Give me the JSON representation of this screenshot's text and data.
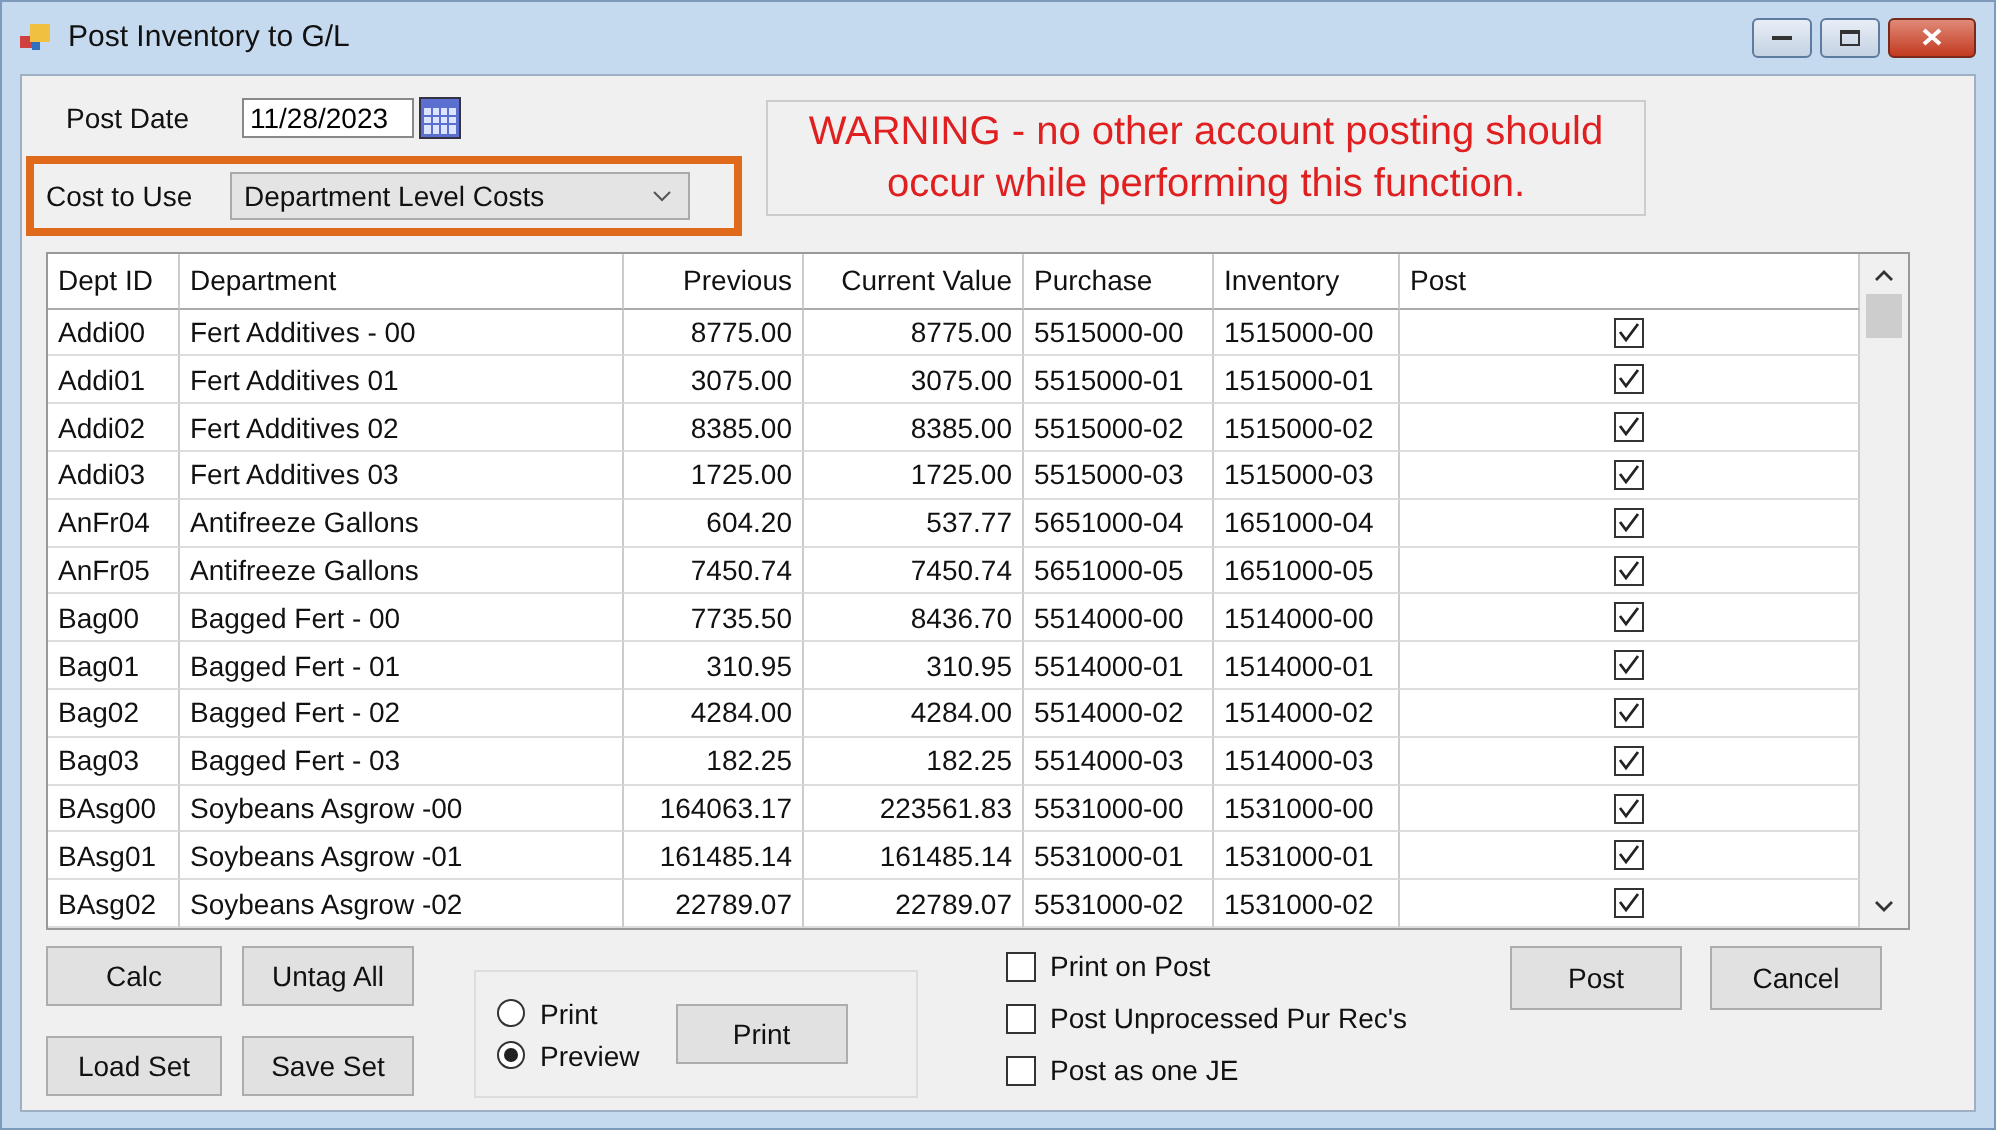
{
  "window": {
    "title": "Post Inventory to G/L"
  },
  "post_date": {
    "label": "Post Date",
    "value": "11/28/2023"
  },
  "cost_to_use": {
    "label": "Cost to Use",
    "value": "Department Level Costs",
    "highlighted": true
  },
  "warning": "WARNING - no other account posting should occur while performing this function.",
  "table": {
    "columns": [
      "Dept ID",
      "Department",
      "Previous",
      "Current Value",
      "Purchase",
      "Inventory",
      "Post"
    ],
    "rows": [
      {
        "cells": [
          "Addi00",
          "Fert Additives - 00",
          "8775.00",
          "8775.00",
          "5515000-00",
          "1515000-00"
        ],
        "post": true
      },
      {
        "cells": [
          "Addi01",
          "Fert Additives 01",
          "3075.00",
          "3075.00",
          "5515000-01",
          "1515000-01"
        ],
        "post": true
      },
      {
        "cells": [
          "Addi02",
          "Fert Additives 02",
          "8385.00",
          "8385.00",
          "5515000-02",
          "1515000-02"
        ],
        "post": true
      },
      {
        "cells": [
          "Addi03",
          "Fert Additives 03",
          "1725.00",
          "1725.00",
          "5515000-03",
          "1515000-03"
        ],
        "post": true
      },
      {
        "cells": [
          "AnFr04",
          "Antifreeze Gallons",
          "604.20",
          "537.77",
          "5651000-04",
          "1651000-04"
        ],
        "post": true
      },
      {
        "cells": [
          "AnFr05",
          "Antifreeze Gallons",
          "7450.74",
          "7450.74",
          "5651000-05",
          "1651000-05"
        ],
        "post": true
      },
      {
        "cells": [
          "Bag00",
          "Bagged Fert - 00",
          "7735.50",
          "8436.70",
          "5514000-00",
          "1514000-00"
        ],
        "post": true
      },
      {
        "cells": [
          "Bag01",
          "Bagged Fert - 01",
          "310.95",
          "310.95",
          "5514000-01",
          "1514000-01"
        ],
        "post": true
      },
      {
        "cells": [
          "Bag02",
          "Bagged Fert - 02",
          "4284.00",
          "4284.00",
          "5514000-02",
          "1514000-02"
        ],
        "post": true
      },
      {
        "cells": [
          "Bag03",
          "Bagged Fert - 03",
          "182.25",
          "182.25",
          "5514000-03",
          "1514000-03"
        ],
        "post": true
      },
      {
        "cells": [
          "BAsg00",
          "Soybeans Asgrow -00",
          "164063.17",
          "223561.83",
          "5531000-00",
          "1531000-00"
        ],
        "post": true
      },
      {
        "cells": [
          "BAsg01",
          "Soybeans Asgrow -01",
          "161485.14",
          "161485.14",
          "5531000-01",
          "1531000-01"
        ],
        "post": true
      },
      {
        "cells": [
          "BAsg02",
          "Soybeans Asgrow -02",
          "22789.07",
          "22789.07",
          "5531000-02",
          "1531000-02"
        ],
        "post": true
      }
    ]
  },
  "left_buttons": [
    "Calc",
    "Untag All",
    "Load Set",
    "Save Set"
  ],
  "print_options": [
    {
      "label": "Print",
      "selected": false
    },
    {
      "label": "Preview",
      "selected": true
    }
  ],
  "print_button": "Print",
  "options": [
    {
      "label": "Print on Post",
      "checked": false
    },
    {
      "label": "Post Unprocessed Pur Rec's",
      "checked": false
    },
    {
      "label": "Post as one JE",
      "checked": false
    }
  ],
  "action_buttons": [
    "Post",
    "Cancel"
  ]
}
